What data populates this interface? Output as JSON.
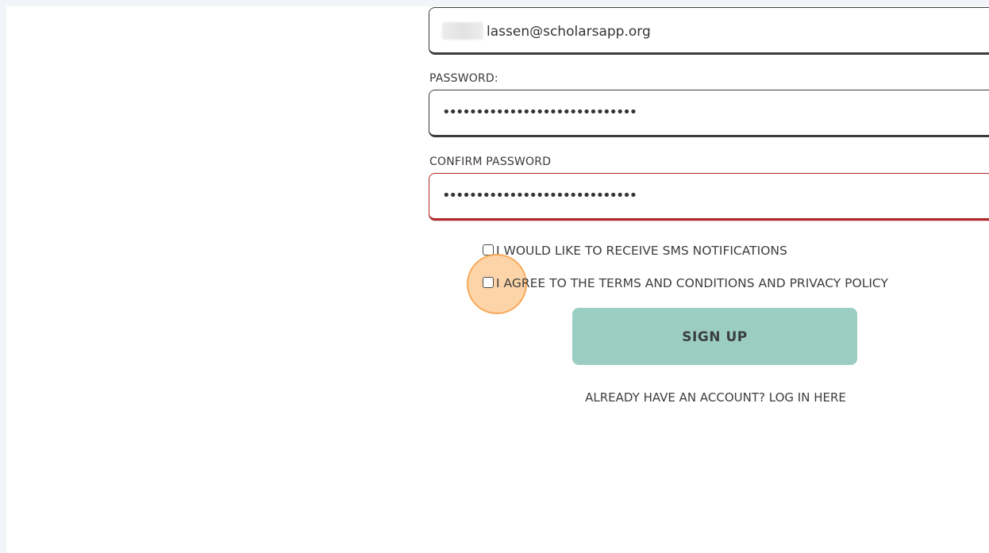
{
  "form": {
    "email": {
      "value": "lassen@scholarsapp.org"
    },
    "password": {
      "label": "PASSWORD:",
      "masked_value": "•••••••••••••••••••••••••••••"
    },
    "confirm_password": {
      "label": "CONFIRM PASSWORD",
      "masked_value": "•••••••••••••••••••••••••••••",
      "state": "error"
    },
    "checkboxes": [
      {
        "label": "I WOULD LIKE TO RECEIVE SMS NOTIFICATIONS",
        "checked": false
      },
      {
        "label": "I AGREE TO THE TERMS AND CONDITIONS AND PRIVACY POLICY",
        "checked": false
      }
    ],
    "submit_label": "SIGN UP",
    "login_link_label": "ALREADY HAVE AN ACCOUNT? LOG IN HERE"
  },
  "colors": {
    "button_bg": "#9ccdc1",
    "error_border": "#b22a2a",
    "click_highlight": "#fbb160",
    "page_bg": "#f1f4f9"
  }
}
